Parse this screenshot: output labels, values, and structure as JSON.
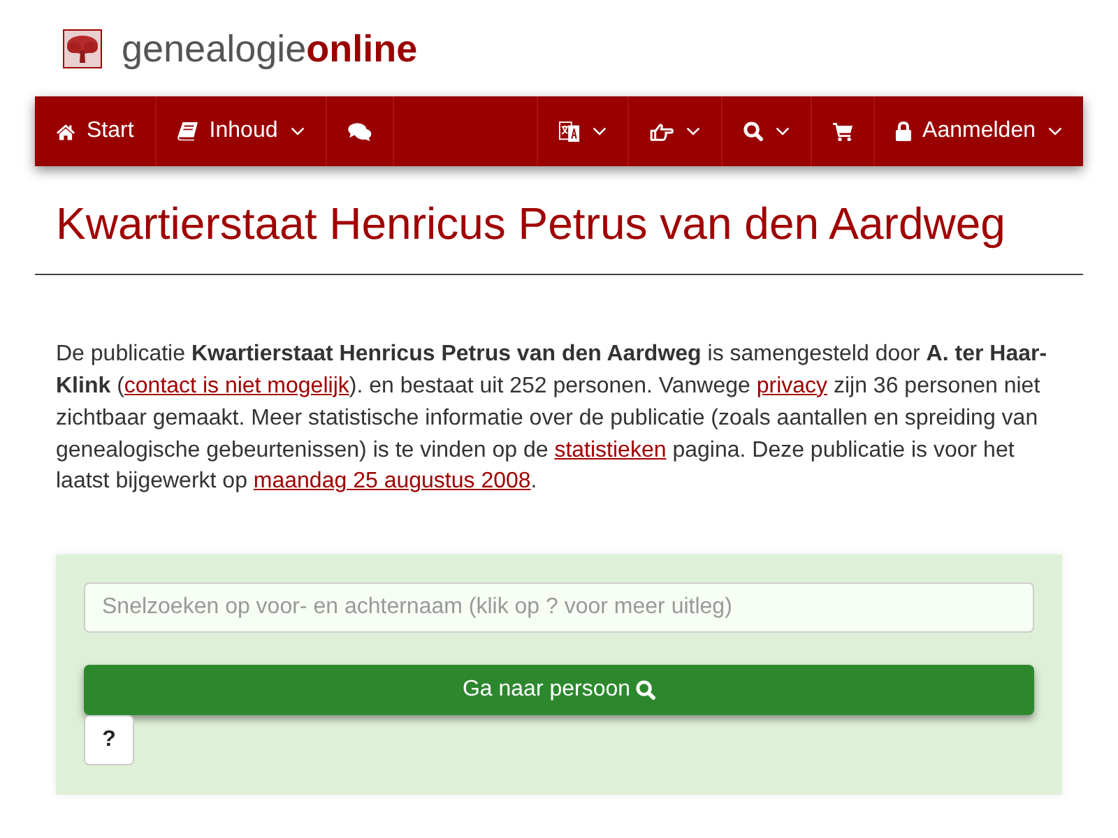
{
  "logo": {
    "text": "genealogie**online**"
  },
  "nav": {
    "left": [
      {
        "label": "Start",
        "dropdown": false
      },
      {
        "label": "Inhoud",
        "dropdown": true
      },
      {
        "dropdown": false
      }
    ],
    "right": [
      {
        "dropdown": true
      },
      {
        "dropdown": true
      },
      {
        "dropdown": true
      },
      {
        "dropdown": false
      },
      {
        "label": "Aanmelden",
        "dropdown": true
      }
    ]
  },
  "title": "Kwartierstaat Henricus Petrus van den Aardweg",
  "intro": [
    {
      "kind": "text",
      "text": "De publicatie **Kwartierstaat Henricus Petrus van den Aardweg** is samengesteld door **A. ter Haar-Klink** ("
    },
    {
      "kind": "link",
      "text": "contact is niet mogelijk"
    },
    {
      "kind": "text",
      "text": "). en bestaat uit 252 personen. Vanwege "
    },
    {
      "kind": "link",
      "text": "privacy"
    },
    {
      "kind": "text",
      "text": " zijn 36 personen niet zichtbaar gemaakt. Meer statistische informatie over de publicatie (zoals aantallen en spreiding van genealogische gebeurtenissen) is te vinden op de "
    },
    {
      "kind": "link",
      "text": "statistieken"
    },
    {
      "kind": "text",
      "text": " pagina. Deze publicatie is voor het laatst bijgewerkt op "
    },
    {
      "kind": "link",
      "text": "maandag 25 augustus 2008"
    },
    {
      "kind": "text",
      "text": "."
    }
  ],
  "search": {
    "placeholder": "Snelzoeken op voor- en achternaam (klik op ? voor meer uitleg)",
    "submit": "Ga naar persoon",
    "help": "?"
  }
}
